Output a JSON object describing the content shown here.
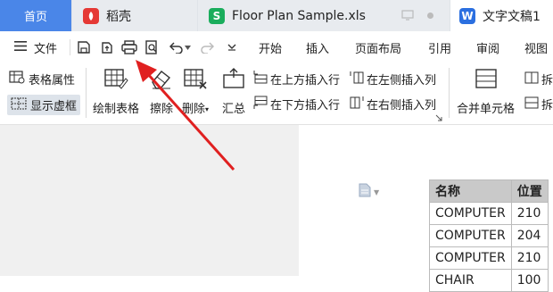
{
  "tabs": {
    "home": "首页",
    "daoke": "稻壳",
    "floor": "Floor Plan Sample.xls",
    "doc": "文字文稿1"
  },
  "menu": {
    "file": "文件",
    "start": "开始",
    "insert": "插入",
    "layout": "页面布局",
    "reference": "引用",
    "review": "审阅",
    "view": "视图"
  },
  "ribbon": {
    "table_props": "表格属性",
    "show_grid": "显示虚框",
    "draw_table": "绘制表格",
    "erase": "擦除",
    "delete": "删除",
    "summary": "汇总",
    "insert_above": "在上方插入行",
    "insert_below": "在下方插入行",
    "insert_left": "在左侧插入列",
    "insert_right": "在右侧插入列",
    "merge": "合并单元格",
    "split_1": "拆",
    "split_2": "拆"
  },
  "table": {
    "headers": [
      "名称",
      "位置"
    ],
    "rows": [
      [
        "COMPUTER",
        "210"
      ],
      [
        "COMPUTER",
        "204"
      ],
      [
        "COMPUTER",
        "210"
      ],
      [
        "CHAIR",
        "100"
      ]
    ]
  },
  "colors": {
    "accent": "#4a86e8",
    "arrow": "#e02020",
    "daoke_icon": "#e53935",
    "sheet_icon": "#1aad5c",
    "doc_icon": "#2b6fe0"
  }
}
